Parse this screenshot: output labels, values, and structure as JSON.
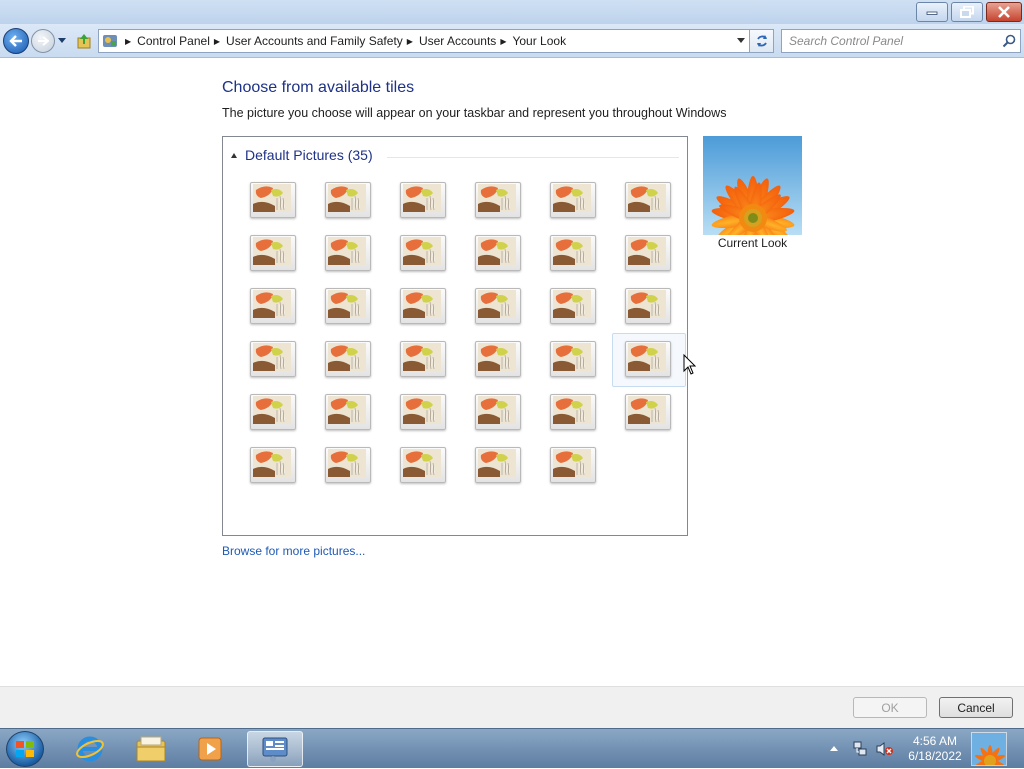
{
  "window": {
    "title_buttons": {
      "minimize_icon": "minimize-icon",
      "maximize_icon": "restore-icon",
      "close_icon": "close-icon"
    }
  },
  "navbar": {
    "breadcrumbs": [
      "Control Panel",
      "User Accounts and Family Safety",
      "User Accounts",
      "Your Look"
    ],
    "search": {
      "placeholder": "Search Control Panel"
    }
  },
  "content": {
    "heading": "Choose from available tiles",
    "subtext": "The picture you choose will appear on your taskbar and represent you throughout Windows",
    "group_title": "Default Pictures (35)",
    "tile_count": 35,
    "current_label": "Current Look",
    "browse_link": "Browse for more pictures..."
  },
  "dialog_buttons": {
    "ok": "OK",
    "cancel": "Cancel"
  },
  "taskbar": {
    "apps": [
      "internet-explorer-icon",
      "windows-explorer-icon",
      "media-player-icon",
      "control-panel-icon"
    ],
    "clock_time": "4:56 AM",
    "clock_date": "6/18/2022"
  },
  "colors": {
    "accent_heading": "#1e3287",
    "link": "#1d5bb5"
  }
}
